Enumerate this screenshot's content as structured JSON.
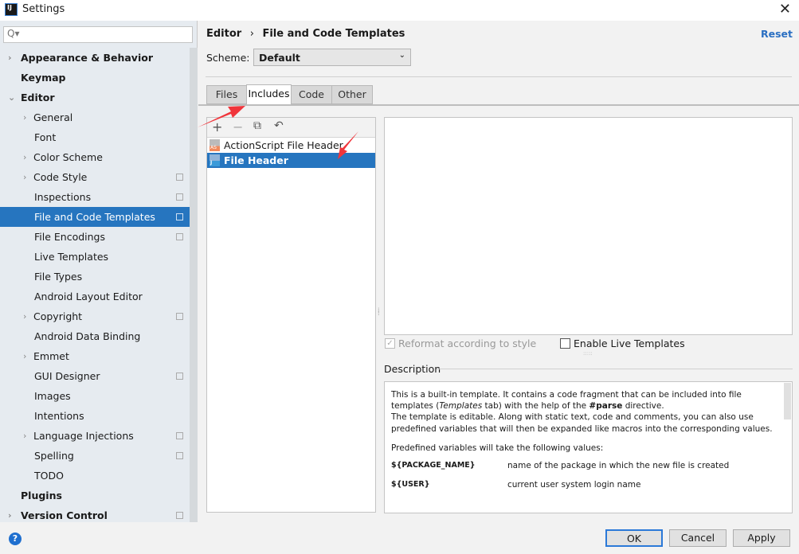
{
  "window": {
    "title": "Settings",
    "app_icon": "IJ",
    "close": "✕"
  },
  "sidebar": {
    "search_placeholder": "Q▾",
    "items": [
      {
        "label": "Appearance & Behavior",
        "level": 0,
        "arrow": "›",
        "bold": true
      },
      {
        "label": "Keymap",
        "level": 0,
        "bold": true
      },
      {
        "label": "Editor",
        "level": 0,
        "arrow": "⌄",
        "bold": true
      },
      {
        "label": "General",
        "level": 1,
        "arrow": "›"
      },
      {
        "label": "Font",
        "level": 1
      },
      {
        "label": "Color Scheme",
        "level": 1,
        "arrow": "›"
      },
      {
        "label": "Code Style",
        "level": 1,
        "arrow": "›",
        "copy": true
      },
      {
        "label": "Inspections",
        "level": 1,
        "copy": true
      },
      {
        "label": "File and Code Templates",
        "level": 1,
        "copy": true,
        "selected": true
      },
      {
        "label": "File Encodings",
        "level": 1,
        "copy": true
      },
      {
        "label": "Live Templates",
        "level": 1
      },
      {
        "label": "File Types",
        "level": 1
      },
      {
        "label": "Android Layout Editor",
        "level": 1
      },
      {
        "label": "Copyright",
        "level": 1,
        "arrow": "›",
        "copy": true
      },
      {
        "label": "Android Data Binding",
        "level": 1
      },
      {
        "label": "Emmet",
        "level": 1,
        "arrow": "›"
      },
      {
        "label": "GUI Designer",
        "level": 1,
        "copy": true
      },
      {
        "label": "Images",
        "level": 1
      },
      {
        "label": "Intentions",
        "level": 1
      },
      {
        "label": "Language Injections",
        "level": 1,
        "arrow": "›",
        "copy": true
      },
      {
        "label": "Spelling",
        "level": 1,
        "copy": true
      },
      {
        "label": "TODO",
        "level": 1
      },
      {
        "label": "Plugins",
        "level": 0,
        "bold": true
      },
      {
        "label": "Version Control",
        "level": 0,
        "arrow": "›",
        "bold": true,
        "copy": true
      }
    ]
  },
  "header": {
    "breadcrumb_parent": "Editor",
    "breadcrumb_sep": "›",
    "breadcrumb_current": "File and Code Templates",
    "reset": "Reset"
  },
  "scheme": {
    "label": "Scheme:",
    "value": "Default"
  },
  "tabs": [
    {
      "label": "Files"
    },
    {
      "label": "Includes",
      "active": true
    },
    {
      "label": "Code"
    },
    {
      "label": "Other"
    }
  ],
  "toolbar": {
    "add": "+",
    "remove": "−",
    "copy": "⧉",
    "reset": "↶"
  },
  "templates": [
    {
      "label": "ActionScript File Header",
      "icon": "actionscript-file-icon",
      "badge": "AS"
    },
    {
      "label": "File Header",
      "icon": "java-file-icon",
      "selected": true,
      "badge": "J"
    }
  ],
  "options": {
    "reformat": "Reformat according to style",
    "reformat_checked": true,
    "reformat_disabled": true,
    "live_templates": "Enable Live Templates",
    "live_checked": false
  },
  "description": {
    "label": "Description",
    "p1a": "This is a built-in template. It contains a code fragment that can be included into file templates (",
    "p1_italic": "Templates",
    "p1b": " tab) with the help of the ",
    "p1_bold": "#parse",
    "p1c": " directive.",
    "p2": "The template is editable. Along with static text, code and comments, you can also use predefined variables that will then be expanded like macros into the corresponding values.",
    "p3": "Predefined variables will take the following values:",
    "vars": [
      {
        "name": "${PACKAGE_NAME}",
        "desc": "name of the package in which the new file is created"
      },
      {
        "name": "${USER}",
        "desc": "current user system login name"
      }
    ]
  },
  "buttons": {
    "ok": "OK",
    "cancel": "Cancel",
    "apply": "Apply",
    "help": "?"
  },
  "colors": {
    "selection": "#2675bf",
    "accent_link": "#2a6fc2",
    "annotation_arrow": "#f0353b"
  }
}
